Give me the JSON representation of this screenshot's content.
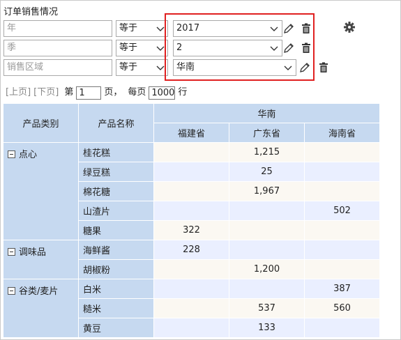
{
  "title": "订单销售情况",
  "filters": [
    {
      "field": "年",
      "operator": "等于",
      "value": "2017"
    },
    {
      "field": "季",
      "operator": "等于",
      "value": "2"
    },
    {
      "field": "销售区域",
      "operator": "等于",
      "value": "华南"
    }
  ],
  "pager": {
    "prev_label": "[上页]",
    "next_label": "[下页]",
    "page_prefix": "第",
    "page_value": "1",
    "page_suffix": "页，",
    "per_page_prefix": "每页",
    "per_page_value": "1000",
    "per_page_suffix": "行"
  },
  "table": {
    "headers": {
      "category": "产品类别",
      "product": "产品名称",
      "region": "华南",
      "provinces": [
        "福建省",
        "广东省",
        "海南省"
      ]
    },
    "groups": [
      {
        "category": "点心",
        "rows": [
          {
            "product": "桂花糕",
            "values": [
              "",
              "1,215",
              ""
            ]
          },
          {
            "product": "绿豆糕",
            "values": [
              "",
              "25",
              ""
            ]
          },
          {
            "product": "棉花糖",
            "values": [
              "",
              "1,967",
              ""
            ]
          },
          {
            "product": "山渣片",
            "values": [
              "",
              "",
              "502"
            ]
          },
          {
            "product": "糖果",
            "values": [
              "322",
              "",
              ""
            ]
          }
        ]
      },
      {
        "category": "调味品",
        "rows": [
          {
            "product": "海鲜酱",
            "values": [
              "228",
              "",
              ""
            ]
          },
          {
            "product": "胡椒粉",
            "values": [
              "",
              "1,200",
              ""
            ]
          }
        ]
      },
      {
        "category": "谷类/麦片",
        "rows": [
          {
            "product": "白米",
            "values": [
              "",
              "",
              "387"
            ]
          },
          {
            "product": "糙米",
            "values": [
              "",
              "537",
              "560"
            ]
          },
          {
            "product": "黄豆",
            "values": [
              "",
              "133",
              ""
            ]
          }
        ]
      }
    ]
  },
  "colors": {
    "header_bg": "#c6d9f0",
    "highlight_border": "#e02020",
    "row_odd": "#fbf8f2",
    "row_even": "#eaefff"
  }
}
